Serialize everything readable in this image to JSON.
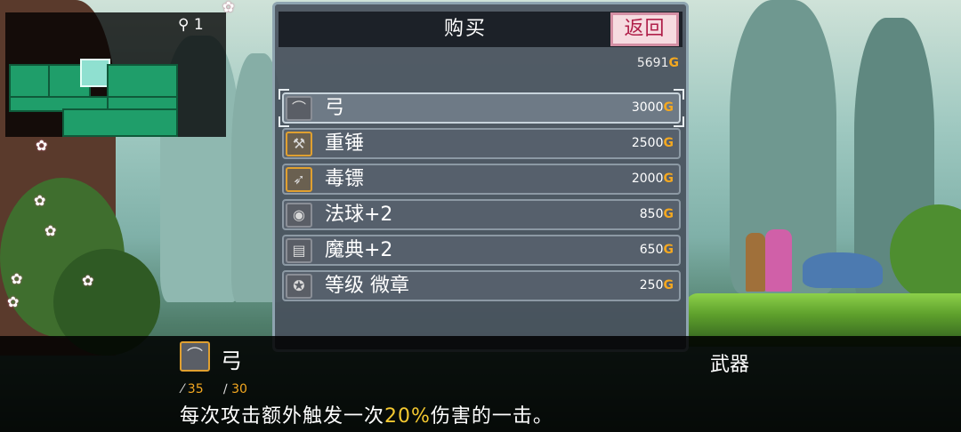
{
  "minimap": {
    "key_icon": "key-icon",
    "key_count": "1"
  },
  "shop": {
    "title": "购买",
    "back_label": "返回",
    "gold_total": "5691",
    "currency": "G",
    "items": [
      {
        "name": "弓",
        "price": "3000",
        "icon": "bow-icon",
        "glyph": "⌒",
        "selected": true
      },
      {
        "name": "重锤",
        "price": "2500",
        "icon": "hammer-icon",
        "glyph": "⚒",
        "selected": false
      },
      {
        "name": "毒镖",
        "price": "2000",
        "icon": "dart-icon",
        "glyph": "➶",
        "selected": false
      },
      {
        "name": "法球+2",
        "price": "850",
        "icon": "orb-icon",
        "glyph": "◉",
        "selected": false
      },
      {
        "name": "魔典+2",
        "price": "650",
        "icon": "tome-icon",
        "glyph": "▤",
        "selected": false
      },
      {
        "name": "等级 微章",
        "price": "250",
        "icon": "badge-icon",
        "glyph": "✪",
        "selected": false
      }
    ]
  },
  "info": {
    "name": "弓",
    "category": "武器",
    "icon": "bow-icon",
    "glyph": "⌒",
    "stat_attack": "35",
    "stat_magic": "30",
    "desc_before": "每次攻击额外触发一次",
    "desc_highlight": "20%",
    "desc_after": "伤害的一击。"
  },
  "colors": {
    "gold": "#f4a820",
    "back_button_bg": "#f6dbe0",
    "back_button_text": "#b0204a",
    "minimap_room": "#1f9e6a"
  }
}
